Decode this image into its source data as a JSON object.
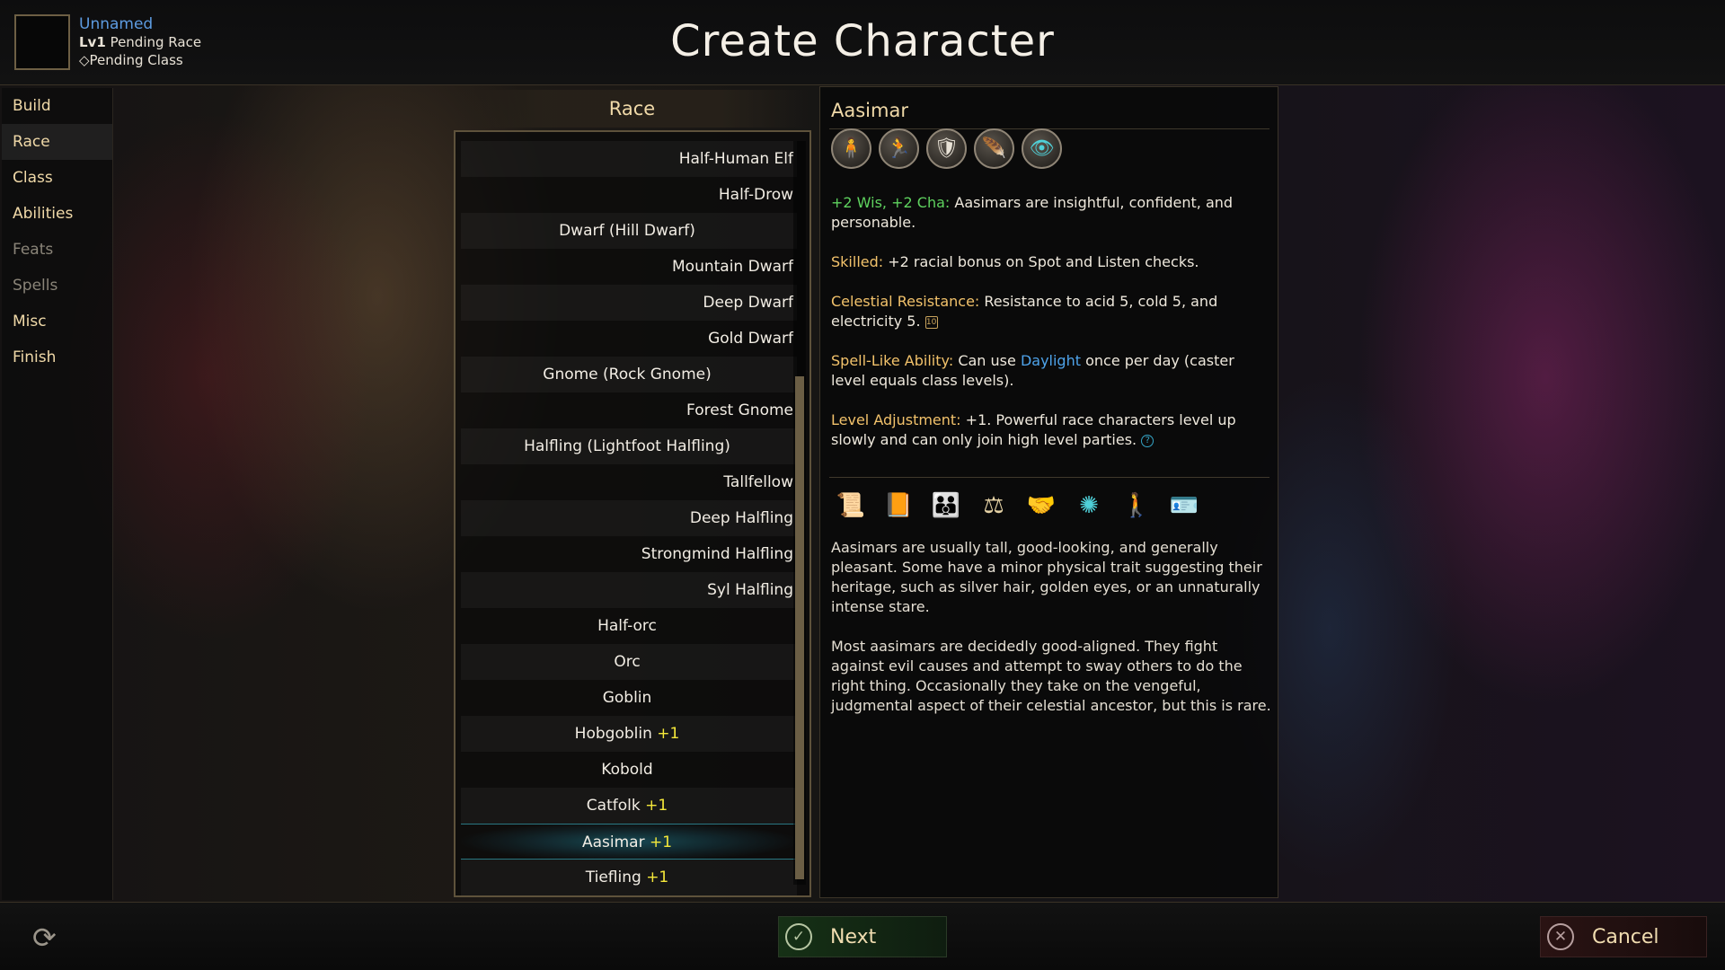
{
  "header": {
    "character_name": "Unnamed",
    "level_prefix": "Lv1",
    "race_status": "Pending Race",
    "class_status": "Pending Class",
    "page_title": "Create Character"
  },
  "nav": {
    "items": [
      {
        "label": "Build"
      },
      {
        "label": "Race"
      },
      {
        "label": "Class"
      },
      {
        "label": "Abilities"
      },
      {
        "label": "Feats"
      },
      {
        "label": "Spells"
      },
      {
        "label": "Misc"
      },
      {
        "label": "Finish"
      }
    ]
  },
  "race": {
    "header": "Race",
    "items": [
      {
        "name": "Half-Human Elf",
        "adj": ""
      },
      {
        "name": "Half-Drow",
        "adj": ""
      },
      {
        "name": "Dwarf (Hill Dwarf)",
        "adj": ""
      },
      {
        "name": "Mountain Dwarf",
        "adj": ""
      },
      {
        "name": "Deep Dwarf",
        "adj": ""
      },
      {
        "name": "Gold Dwarf",
        "adj": ""
      },
      {
        "name": "Gnome (Rock Gnome)",
        "adj": ""
      },
      {
        "name": "Forest Gnome",
        "adj": ""
      },
      {
        "name": "Halfling (Lightfoot Halfling)",
        "adj": ""
      },
      {
        "name": "Tallfellow",
        "adj": ""
      },
      {
        "name": "Deep Halfling",
        "adj": ""
      },
      {
        "name": "Strongmind Halfling",
        "adj": ""
      },
      {
        "name": "Syl Halfling",
        "adj": ""
      },
      {
        "name": "Half-orc",
        "adj": ""
      },
      {
        "name": "Orc",
        "adj": ""
      },
      {
        "name": "Goblin",
        "adj": ""
      },
      {
        "name": "Hobgoblin",
        "adj": "+1"
      },
      {
        "name": "Kobold",
        "adj": ""
      },
      {
        "name": "Catfolk",
        "adj": "+1"
      },
      {
        "name": "Aasimar",
        "adj": "+1"
      },
      {
        "name": "Tiefling",
        "adj": "+1"
      }
    ],
    "selected": "Aasimar"
  },
  "detail": {
    "title": "Aasimar",
    "trait_icons": [
      "humanoid-icon",
      "running-figure-icon",
      "shield-sword-icon",
      "bird-helm-icon",
      "eye-icon"
    ],
    "traits": {
      "abilities_label": "+2 Wis, +2 Cha:",
      "abilities_text": "Aasimars are insightful, confident, and personable.",
      "skilled_label": "Skilled:",
      "skilled_text": "+2 racial bonus on Spot and Listen checks.",
      "resist_label": "Celestial Resistance:",
      "resist_text": "Resistance to acid 5, cold 5, and electricity 5.",
      "resist_badge": "10",
      "spell_label": "Spell-Like Ability:",
      "spell_text_1": "Can use",
      "spell_link": "Daylight",
      "spell_text_2": "once per day (caster level equals class levels).",
      "la_label": "Level Adjustment:",
      "la_text": "+1. Powerful race characters level up slowly and can only join high level parties.",
      "la_badge": "?"
    },
    "feature_icons": [
      "scroll-icon",
      "book-icon",
      "family-icon",
      "council-icon",
      "handshake-icon",
      "deity-icon",
      "traveler-icon",
      "id-card-icon"
    ],
    "description": [
      "Aasimars are usually tall, good-looking, and generally pleasant. Some have a minor physical trait suggesting their heritage, such as silver hair, golden eyes, or an unnaturally intense stare.",
      "Most aasimars are decidedly good-aligned. They fight against evil causes and attempt to sway others to do the right thing. Occasionally they take on the vengeful, judgmental aspect of their celestial ancestor, but this is rare."
    ]
  },
  "footer": {
    "next_label": "Next",
    "cancel_label": "Cancel"
  }
}
